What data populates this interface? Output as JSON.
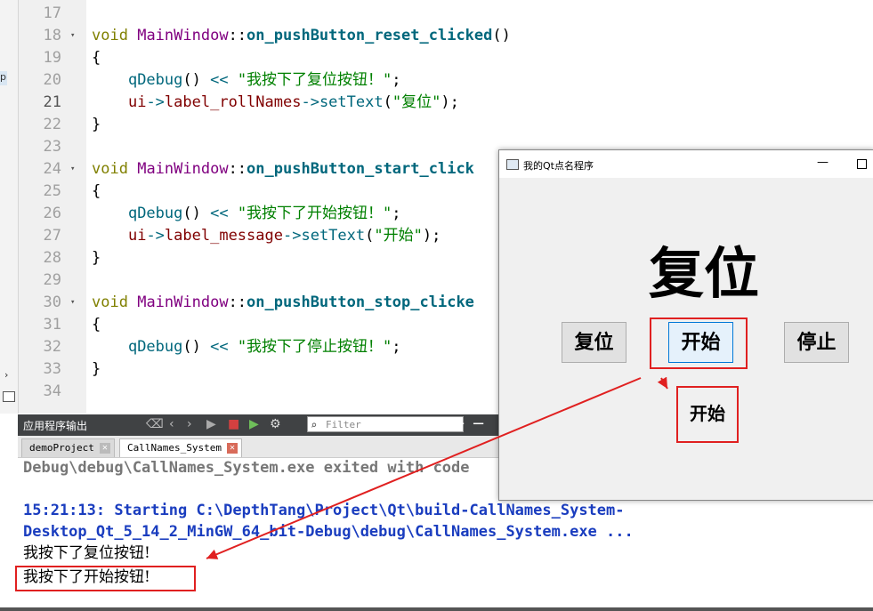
{
  "editor": {
    "line_numbers": [
      "17",
      "18",
      "19",
      "20",
      "21",
      "22",
      "23",
      "24",
      "25",
      "26",
      "27",
      "28",
      "29",
      "30",
      "31",
      "32",
      "33",
      "34"
    ],
    "current_line": "21",
    "lines": [
      {
        "type": "blank"
      },
      {
        "type": "fn_def",
        "ret": "void",
        "cls": "MainWindow",
        "sep": "::",
        "name": "on_pushButton_reset_clicked",
        "args": "()"
      },
      {
        "type": "text",
        "text": "{"
      },
      {
        "type": "debug",
        "call": "qDebug",
        "paren": "()",
        "op": " << ",
        "str": "\"我按下了复位按钮！\"",
        "end": ";"
      },
      {
        "type": "settext",
        "obj": "ui",
        "arrow": "->",
        "member": "label_rollNames",
        "arrow2": "->",
        "method": "setText",
        "str": "\"复位\"",
        "end": ");"
      },
      {
        "type": "text",
        "text": "}"
      },
      {
        "type": "blank"
      },
      {
        "type": "fn_def",
        "ret": "void",
        "cls": "MainWindow",
        "sep": "::",
        "name": "on_pushButton_start_click",
        "args": ""
      },
      {
        "type": "text",
        "text": "{"
      },
      {
        "type": "debug",
        "call": "qDebug",
        "paren": "()",
        "op": " << ",
        "str": "\"我按下了开始按钮！\"",
        "end": ";"
      },
      {
        "type": "settext",
        "obj": "ui",
        "arrow": "->",
        "member": "label_message",
        "arrow2": "->",
        "method": "setText",
        "str": "\"开始\"",
        "end": ");"
      },
      {
        "type": "text",
        "text": "}"
      },
      {
        "type": "blank"
      },
      {
        "type": "fn_def",
        "ret": "void",
        "cls": "MainWindow",
        "sep": "::",
        "name": "on_pushButton_stop_clicke",
        "args": ""
      },
      {
        "type": "text",
        "text": "{"
      },
      {
        "type": "debug",
        "call": "qDebug",
        "paren": "()",
        "op": " << ",
        "str": "\"我按下了停止按钮！\"",
        "end": ";"
      },
      {
        "type": "text",
        "text": "}"
      },
      {
        "type": "blank"
      }
    ]
  },
  "output": {
    "pane_title": "应用程序输出",
    "filter_placeholder": "Filter",
    "tabs": [
      {
        "label": "demoProject"
      },
      {
        "label": "CallNames_System"
      }
    ],
    "lines": [
      "Debug\\debug\\CallNames_System.exe exited with code",
      "",
      "15:21:13: Starting C:\\DepthTang\\Project\\Qt\\build-CallNames_System-",
      "Desktop_Qt_5_14_2_MinGW_64_bit-Debug\\debug\\CallNames_System.exe ...",
      "我按下了复位按钮!",
      "我按下了开始按钮!"
    ]
  },
  "qt_window": {
    "title": "我的Qt点名程序",
    "big_label": "复位",
    "buttons": {
      "reset": "复位",
      "start": "开始",
      "stop": "停止"
    },
    "popup_label": "开始"
  },
  "colors": {
    "annotation": "#e02020",
    "accent": "#0078d7"
  }
}
